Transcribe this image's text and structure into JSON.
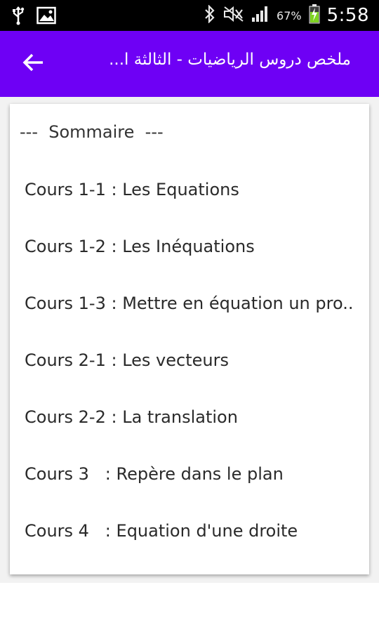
{
  "status_bar": {
    "battery": "67%",
    "time": "5:58",
    "icons": [
      "usb-icon",
      "image-icon",
      "bluetooth-icon",
      "mute-icon",
      "signal-icon",
      "battery-charging-icon"
    ]
  },
  "app_bar": {
    "title": "ملخص دروس الرياضيات - الثالثة ا...",
    "back_icon": "arrow-left-icon",
    "color": "#6e00f5"
  },
  "summary": {
    "heading": "---  Sommaire  ---",
    "items": [
      {
        "label": "Cours 1-1 : Les Equations"
      },
      {
        "label": "Cours 1-2 : Les Inéquations"
      },
      {
        "label": "Cours 1-3 : Mettre en équation un pro.."
      },
      {
        "label": "Cours 2-1 : Les vecteurs"
      },
      {
        "label": "Cours 2-2 : La translation"
      },
      {
        "label": "Cours 3   : Repère dans le plan"
      },
      {
        "label": "Cours 4   : Equation d'une droite"
      }
    ]
  }
}
